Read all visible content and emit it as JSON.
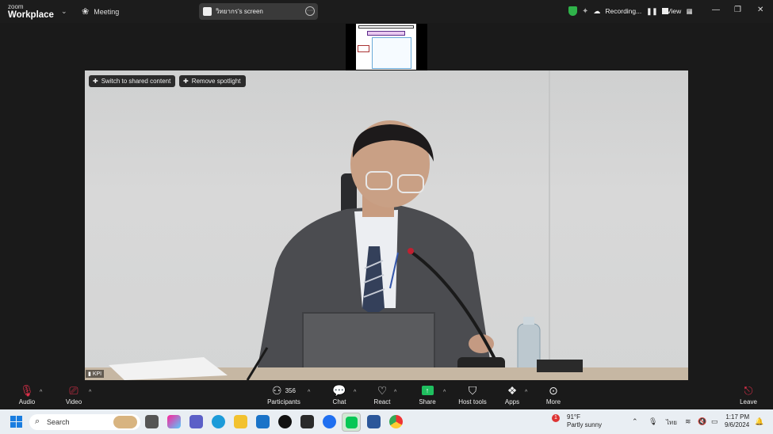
{
  "titlebar": {
    "brand_top": "zoom",
    "brand_bottom": "Workplace",
    "meeting_label": "Meeting",
    "screen_label": "วิทยากร's screen",
    "recording_label": "Recording...",
    "view_label": "View"
  },
  "stage": {
    "switch_button": "Switch to shared content",
    "remove_button": "Remove spotlight",
    "participant_name": "KPI"
  },
  "toolbar": {
    "audio": "Audio",
    "video": "Video",
    "participants": "Participants",
    "participants_count": "356",
    "chat": "Chat",
    "react": "React",
    "share": "Share",
    "host_tools": "Host tools",
    "apps": "Apps",
    "more": "More",
    "leave": "Leave"
  },
  "taskbar": {
    "search_placeholder": "Search",
    "weather_temp": "91°F",
    "weather_desc": "Partly sunny",
    "weather_badge": "1",
    "lang": "ไทย",
    "time": "1:17 PM",
    "date": "9/6/2024"
  },
  "colors": {
    "accent_share": "#1fbf5f",
    "mute_red": "#e0304a",
    "shield_green": "#2fb34a",
    "windows_blue": "#1a7de0"
  }
}
